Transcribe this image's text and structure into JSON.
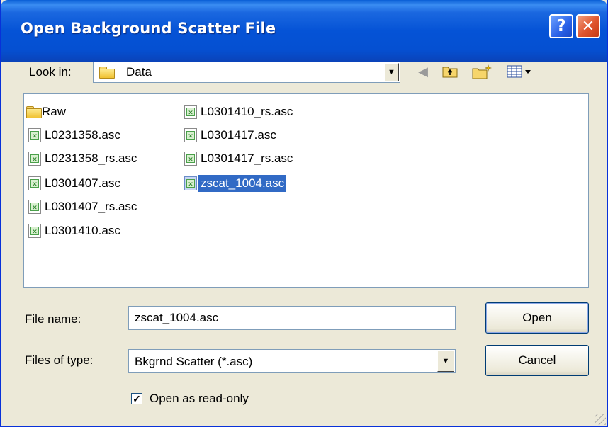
{
  "window": {
    "title": "Open Background Scatter File"
  },
  "titlebar": {
    "help_label": "?",
    "close_label": "✕"
  },
  "lookin": {
    "label": "Look in:",
    "value": "Data"
  },
  "files": {
    "column1": [
      "Raw",
      "L0231358.asc",
      "L0231358_rs.asc",
      "L0301407.asc",
      "L0301407_rs.asc",
      "L0301410.asc"
    ],
    "column2": [
      "L0301410_rs.asc",
      "L0301417.asc",
      "L0301417_rs.asc",
      "zscat_1004.asc"
    ],
    "selected": "zscat_1004.asc"
  },
  "filename": {
    "label": "File name:",
    "value": "zscat_1004.asc"
  },
  "filetype": {
    "label": "Files of type:",
    "value": "Bkgrnd Scatter (*.asc)"
  },
  "buttons": {
    "open": "Open",
    "cancel": "Cancel"
  },
  "readonly": {
    "label": "Open as read-only",
    "checked": true,
    "mark": "✓"
  },
  "icons": {
    "back": "back-arrow-icon",
    "up": "up-folder-icon",
    "new": "new-folder-icon",
    "view": "view-menu-icon"
  }
}
